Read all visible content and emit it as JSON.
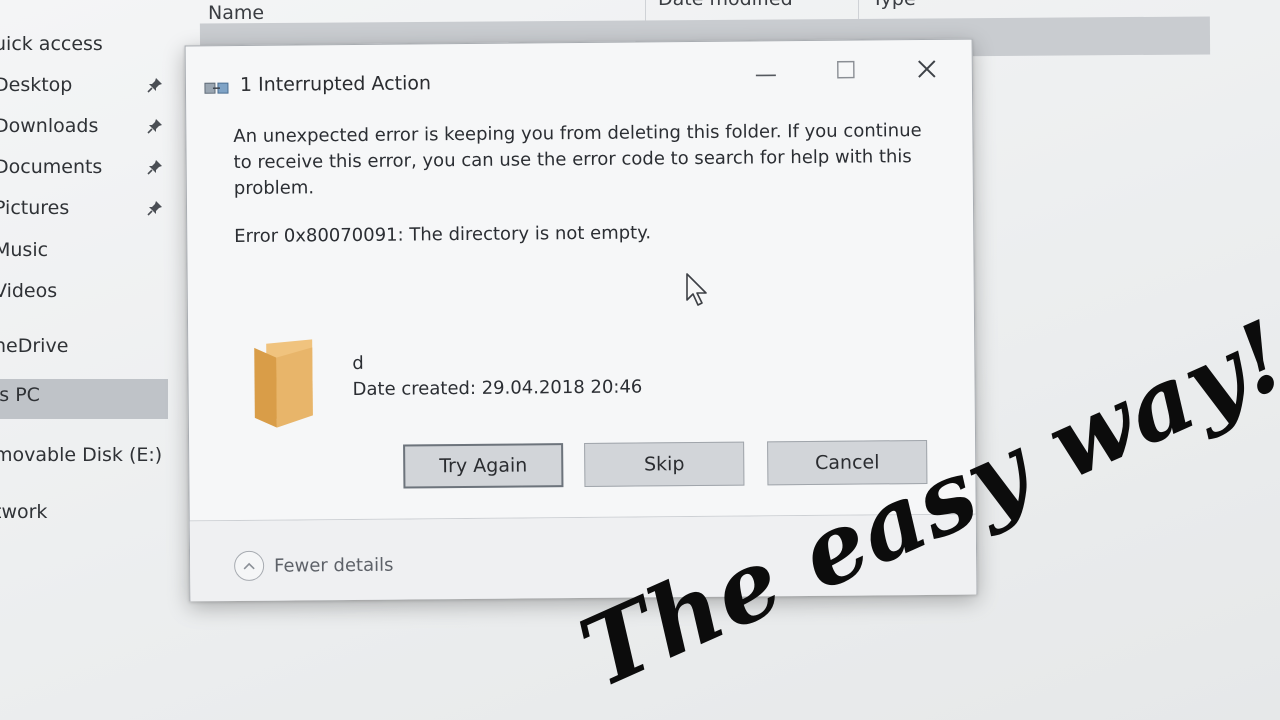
{
  "explorer": {
    "columns": {
      "name": "Name",
      "date_modified": "Date modified",
      "type": "Type"
    },
    "nav": {
      "items": [
        {
          "label": "uick access",
          "pinned": false
        },
        {
          "label": "Desktop",
          "pinned": true
        },
        {
          "label": "Downloads",
          "pinned": true
        },
        {
          "label": "Documents",
          "pinned": true
        },
        {
          "label": "Pictures",
          "pinned": true
        },
        {
          "label": "Music",
          "pinned": false
        },
        {
          "label": "Videos",
          "pinned": false
        },
        {
          "label": "neDrive",
          "pinned": false
        },
        {
          "label": "is PC",
          "pinned": false,
          "selected": true
        },
        {
          "label": "movable Disk (E:)",
          "pinned": false
        },
        {
          "label": "twork",
          "pinned": false
        }
      ]
    }
  },
  "dialog": {
    "title": "1 Interrupted Action",
    "message": "An unexpected error is keeping you from deleting this folder. If you continue to receive this error, you can use the error code to search for help with this problem.",
    "error": "Error 0x80070091: The directory is not empty.",
    "item": {
      "name": "d",
      "date_created": "Date created: 29.04.2018 20:46"
    },
    "buttons": {
      "try_again": "Try Again",
      "skip": "Skip",
      "cancel": "Cancel"
    },
    "footer": {
      "fewer_details": "Fewer details"
    },
    "window_controls": [
      "minimize-icon",
      "maximize-icon",
      "close-icon"
    ]
  },
  "overlay": {
    "text": "The easy way!"
  },
  "colors": {
    "folder": "#e8b56a",
    "folder_dark": "#d49a45",
    "overlay_text": "#0c0c0c",
    "selected_nav": "#bfc3c8"
  }
}
